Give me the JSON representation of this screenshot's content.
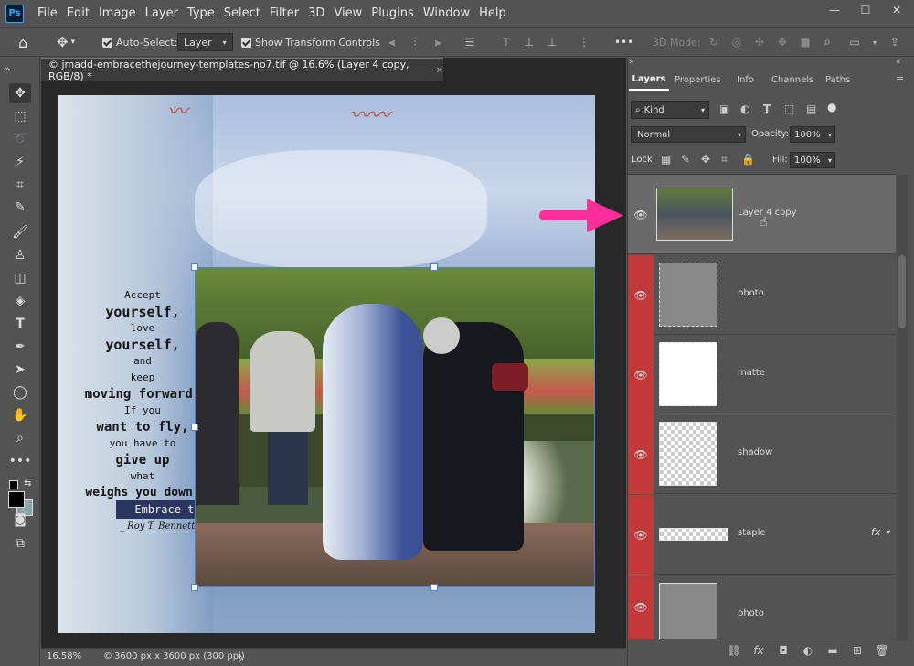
{
  "app": {
    "logo": "Ps"
  },
  "menu": [
    "File",
    "Edit",
    "Image",
    "Layer",
    "Type",
    "Select",
    "Filter",
    "3D",
    "View",
    "Plugins",
    "Window",
    "Help"
  ],
  "window_controls": {
    "minimize": "—",
    "restore": "☐",
    "close": "✕"
  },
  "options": {
    "auto_select_label": "Auto-Select:",
    "auto_select_value": "Layer",
    "show_transform_label": "Show Transform Controls",
    "more": "•••",
    "mode_3d": "3D Mode:"
  },
  "document": {
    "tab_title": "© jmadd-embracethejourney-templates-no7.tif @ 16.6% (Layer 4 copy, RGB/8) *",
    "tab_close": "✕",
    "zoom": "16.58%",
    "size_info": "3600 px x 3600 px (300 ppi)",
    "status_arrow": "〉"
  },
  "quote": {
    "lines": [
      "Accept",
      "yourself,",
      "love",
      "yourself,",
      "and",
      "keep",
      "moving forward.",
      "If you",
      "want to fly,",
      "you have to",
      "give up",
      "what",
      "weighs you down."
    ],
    "banner": "Embrace the Journey",
    "author": "_ Roy T. Bennett"
  },
  "panel": {
    "tabs": [
      "Layers",
      "Properties",
      "Info",
      "Channels",
      "Paths"
    ],
    "filter_kind": "Kind",
    "blend_mode": "Normal",
    "opacity_label": "Opacity:",
    "opacity_value": "100%",
    "lock_label": "Lock:",
    "fill_label": "Fill:",
    "fill_value": "100%"
  },
  "layers": [
    {
      "name": "Layer 4 copy",
      "selected": true
    },
    {
      "name": "photo",
      "selected": false
    },
    {
      "name": "matte",
      "selected": false
    },
    {
      "name": "shadow",
      "selected": false
    },
    {
      "name": "staple",
      "selected": false,
      "fx": "fx"
    },
    {
      "name": "photo",
      "selected": false
    }
  ],
  "colors": {
    "accent_red": "#c0393b",
    "arrow_pink": "#ff2e9a",
    "selected_row": "#6a6a6a"
  }
}
